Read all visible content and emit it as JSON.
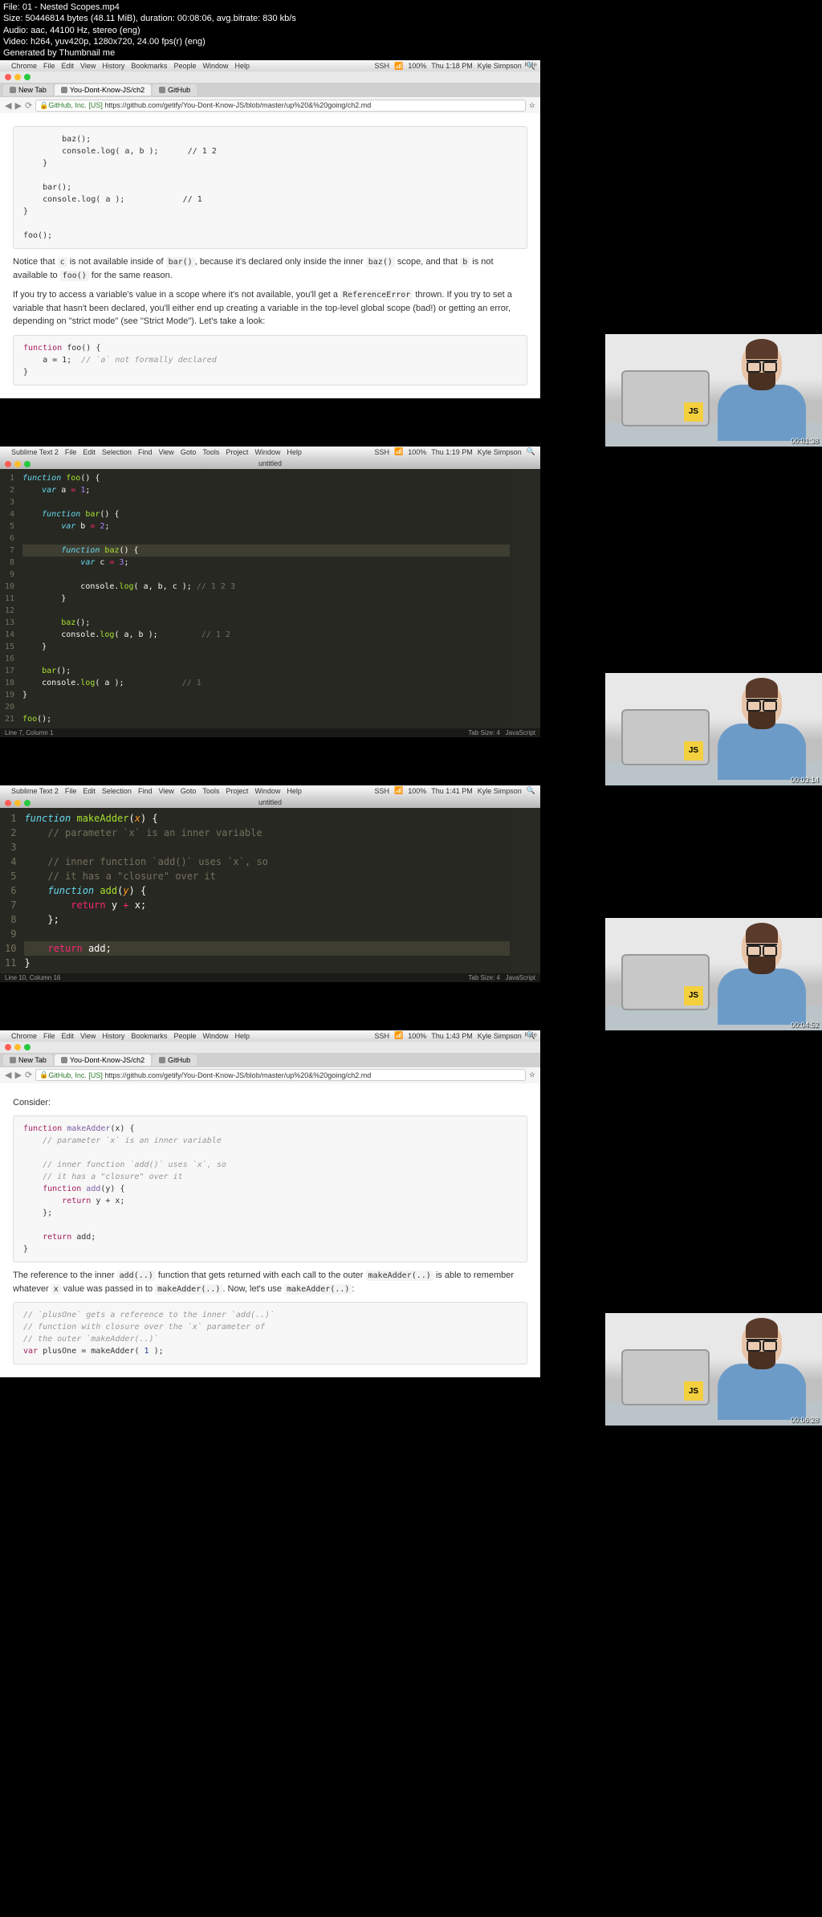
{
  "meta": {
    "file": "File: 01 - Nested Scopes.mp4",
    "size": "Size: 50446814 bytes (48.11 MiB), duration: 00:08:06, avg.bitrate: 830 kb/s",
    "audio": "Audio: aac, 44100 Hz, stereo (eng)",
    "video": "Video: h264, yuv420p, 1280x720, 24.00 fps(r) (eng)",
    "gen": "Generated by Thumbnail me"
  },
  "menubar": {
    "apple": "",
    "items": [
      "Chrome",
      "File",
      "Edit",
      "View",
      "History",
      "Bookmarks",
      "People",
      "Window",
      "Help"
    ],
    "sublime_items": [
      "Sublime Text 2",
      "File",
      "Edit",
      "Selection",
      "Find",
      "View",
      "Goto",
      "Tools",
      "Project",
      "Window",
      "Help"
    ],
    "battery": "100%",
    "time1": "Thu 1:18 PM",
    "time2": "Thu 1:19 PM",
    "time3": "Thu 1:41 PM",
    "time4": "Thu 1:43 PM",
    "user": "Kyle Simpson",
    "ssh": "SSH"
  },
  "browser": {
    "tabs": [
      "New Tab",
      "You-Dont-Know-JS/ch2",
      "GitHub"
    ],
    "kyle": "Kyle",
    "url_prefix": "GitHub, Inc. [US]",
    "url": "https://github.com/getify/You-Dont-Know-JS/blob/master/up%20&%20going/ch2.md"
  },
  "gh1": {
    "code1": "        baz();\n        console.log( a, b );      // 1 2\n    }\n\n    bar();\n    console.log( a );            // 1\n}\n\nfoo();",
    "para1_pre": "Notice that ",
    "para1_c": "c",
    "para1_mid": " is not available inside of ",
    "para1_bar": "bar()",
    "para1_mid2": ", because it's declared only inside the inner ",
    "para1_baz": "baz()",
    "para1_mid3": " scope, and that ",
    "para1_b": "b",
    "para1_mid4": " is not available to ",
    "para1_foo": "foo()",
    "para1_end": " for the same reason.",
    "para2_pre": "If you try to access a variable's value in a scope where it's not available, you'll get a ",
    "para2_ref": "ReferenceError",
    "para2_end": " thrown. If you try to set a variable that hasn't been declared, you'll either end up creating a variable in the top-level global scope (bad!) or getting an error, depending on \"strict mode\" (see \"Strict Mode\"). Let's take a look:",
    "code2_1": "function",
    "code2_2": " foo() {",
    "code2_3": "    a = 1;  ",
    "code2_4": "// `a` not formally declared",
    "code2_5": "}"
  },
  "sublime1": {
    "title": "untitled",
    "lines": [
      "1",
      "2",
      "3",
      "4",
      "5",
      "6",
      "7",
      "8",
      "9",
      "10",
      "11",
      "12",
      "13",
      "14",
      "15",
      "16",
      "17",
      "18",
      "19",
      "20",
      "21"
    ],
    "status_left": "Line 7, Column 1",
    "status_tab": "Tab Size: 4",
    "status_lang": "JavaScript"
  },
  "sublime2": {
    "title": "untitled",
    "lines": [
      "1",
      "2",
      "3",
      "4",
      "5",
      "6",
      "7",
      "8",
      "9",
      "10",
      "11"
    ],
    "status_left": "Line 10, Column 16",
    "status_tab": "Tab Size: 4",
    "status_lang": "JavaScript"
  },
  "gh2": {
    "consider": "Consider:",
    "code1_raw": "function makeAdder(x) {\n    // parameter `x` is an inner variable\n\n    // inner function `add()` uses `x`, so\n    // it has a \"closure\" over it\n    function add(y) {\n        return y + x;\n    };\n\n    return add;\n}",
    "para_pre": "The reference to the inner ",
    "para_add": "add(..)",
    "para_mid": " function that gets returned with each call to the outer ",
    "para_ma": "makeAdder(..)",
    "para_mid2": " is able to remember whatever ",
    "para_x": "x",
    "para_mid3": " value was passed in to ",
    "para_ma2": "makeAdder(..)",
    "para_mid4": ". Now, let's use ",
    "para_ma3": "makeAdder(..)",
    "para_end": ":",
    "code2_c1": "// `plusOne` gets a reference to the inner `add(..)`",
    "code2_c2": "// function with closure over the `x` parameter of",
    "code2_c3": "// the outer `makeAdder(..)`",
    "code2_l": "var plusOne = makeAdder( 1 );"
  },
  "timestamps": {
    "t1": "00:01:38",
    "t2": "00:03:14",
    "t3": "00:04:52",
    "t4": "00:06:28"
  },
  "js_sticker": "JS"
}
